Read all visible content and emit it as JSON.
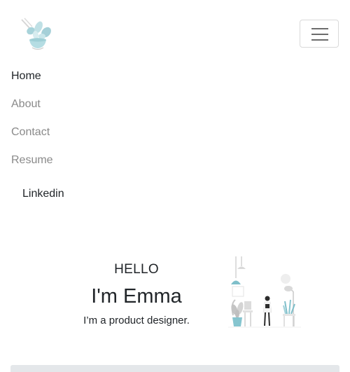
{
  "nav": {
    "items": [
      {
        "label": "Home",
        "active": true
      },
      {
        "label": "About",
        "active": false
      },
      {
        "label": "Contact",
        "active": false
      },
      {
        "label": "Resume",
        "active": false
      }
    ],
    "social": {
      "label": "Linkedin"
    }
  },
  "hero": {
    "greeting": "HELLO",
    "name": "I'm Emma",
    "tagline": "I’m a product designer."
  },
  "icons": {
    "logo": "leaf-logo-icon",
    "menu": "hamburger-menu-icon",
    "illustration": "designer-workspace-illustration"
  },
  "colors": {
    "text": "#212529",
    "muted": "#8a8a8a",
    "accent": "#86c5cf",
    "footer": "#e4e7ea"
  }
}
